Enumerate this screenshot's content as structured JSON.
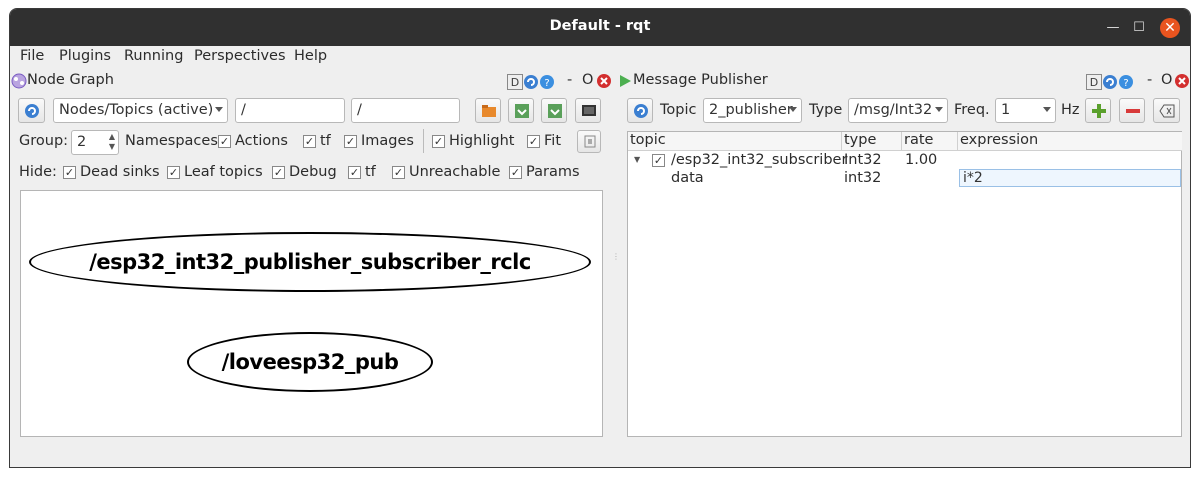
{
  "window": {
    "title": "Default - rqt"
  },
  "menu": [
    "File",
    "Plugins",
    "Running",
    "Perspectives",
    "Help"
  ],
  "node_graph": {
    "title": "Node Graph",
    "header_buttons": {
      "d": "D",
      "dash": "-",
      "o": "O"
    },
    "mode": "Nodes/Topics (active)",
    "filter1": "/",
    "filter2": "/",
    "group_label": "Group:",
    "group_value": "2",
    "options": [
      "Namespaces",
      "Actions",
      "tf",
      "Images",
      "Highlight",
      "Fit"
    ],
    "hide_label": "Hide:",
    "hide_options": [
      "Dead sinks",
      "Leaf topics",
      "Debug",
      "tf",
      "Unreachable",
      "Params"
    ],
    "nodes": [
      "/esp32_int32_publisher_subscriber_rclc",
      "/loveesp32_pub"
    ]
  },
  "publisher": {
    "title": "Message Publisher",
    "header_buttons": {
      "d": "D",
      "dash": "-",
      "o": "O"
    },
    "topic_label": "Topic",
    "topic_value": "2_publisher",
    "type_label": "Type",
    "type_value": "/msg/Int32",
    "freq_label": "Freq.",
    "freq_value": "1",
    "hz_label": "Hz",
    "columns": [
      "topic",
      "type",
      "rate",
      "expression"
    ],
    "rows": [
      {
        "topic": "/esp32_int32_subscriber",
        "type": "Int32",
        "rate": "1.00",
        "expression": ""
      },
      {
        "topic": "data",
        "type": "int32",
        "rate": "",
        "expression": "i*2"
      }
    ]
  },
  "colors": {
    "titlebar": "#303030",
    "close": "#e9541f",
    "add": "#5aa02c",
    "remove": "#d83a3a"
  }
}
